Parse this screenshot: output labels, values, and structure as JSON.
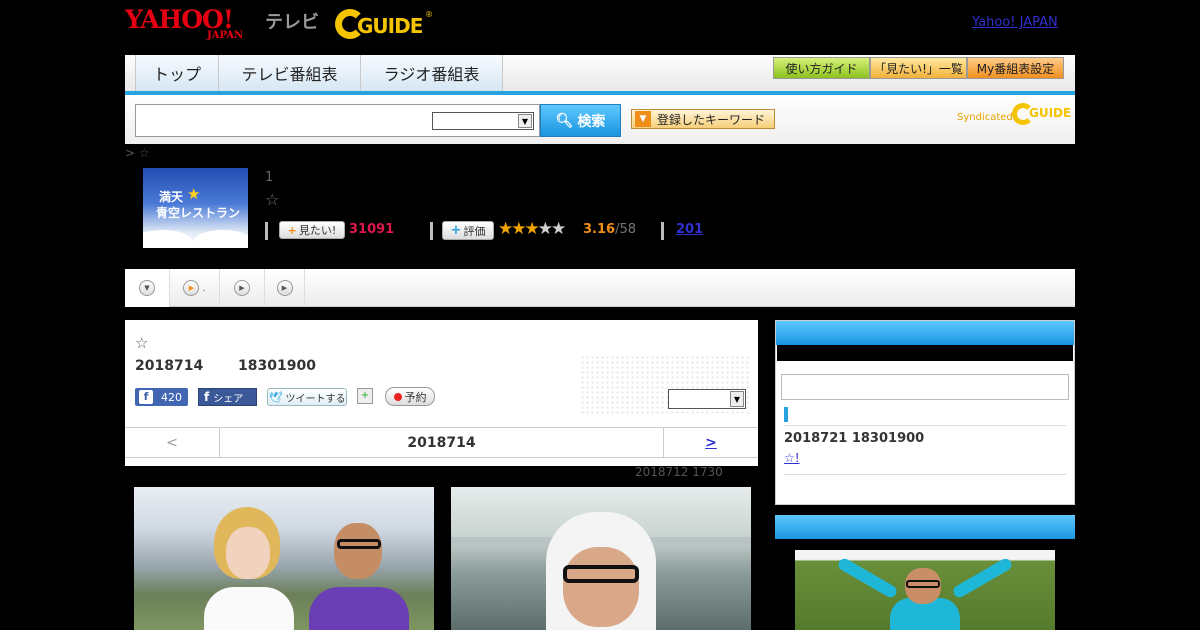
{
  "header": {
    "yahoo_logo": "YAHOO!",
    "yahoo_japan_sub": "JAPAN",
    "tv_label": "テレビ",
    "gguide_logo": "GUIDE",
    "gguide_reg": "®",
    "yahoo_japan_link": "Yahoo! JAPAN",
    "brand_color": "#e60012",
    "gguide_color": "#f5c400"
  },
  "nav": {
    "tabs": [
      {
        "label": "トップ"
      },
      {
        "label": "テレビ番組表"
      },
      {
        "label": "ラジオ番組表"
      }
    ],
    "buttons": [
      {
        "label": "使い方ガイド"
      },
      {
        "label": "「見たい!」一覧"
      },
      {
        "label": "My番組表設定"
      }
    ],
    "accent_color": "#29a3e0"
  },
  "search": {
    "input_value": "",
    "select_value": "",
    "button_label": "検索",
    "keyword_button_label": "登録したキーワード",
    "syndicated_label": "Syndicated",
    "syndicated_logo": "GUIDE"
  },
  "breadcrumb": "> ☆",
  "program": {
    "thumb_line1": "満天",
    "thumb_line2": "青空レストラン",
    "episode_num": "1",
    "star": "☆",
    "mitai_label": "見たい!",
    "mitai_count": "31091",
    "hyouka_label": "評価",
    "rating_stars_on": 3,
    "rating_stars_total": 5,
    "rating_value": "3.16",
    "rating_count": "/58",
    "review_link": "201"
  },
  "tabs": [
    {
      "icon": "dropdown-circle-icon",
      "label": ""
    },
    {
      "icon": "play-circle-icon",
      "label": "."
    },
    {
      "icon": "play-circle-icon",
      "label": ""
    },
    {
      "icon": "play-circle-icon",
      "label": ""
    }
  ],
  "main": {
    "star": "☆",
    "date": "2018714",
    "time": "18301900",
    "fb_like_count": "420",
    "fb_share_label": "シェア",
    "tweet_label": "ツイートする",
    "yoyaku_label": "予約",
    "select_value": "",
    "nav_prev": "<",
    "nav_current": "2018714",
    "nav_next": ">",
    "updated": "2018712  1730"
  },
  "sidebar": {
    "input_value": "",
    "next_date": "2018721  18301900",
    "next_link": "☆!"
  }
}
